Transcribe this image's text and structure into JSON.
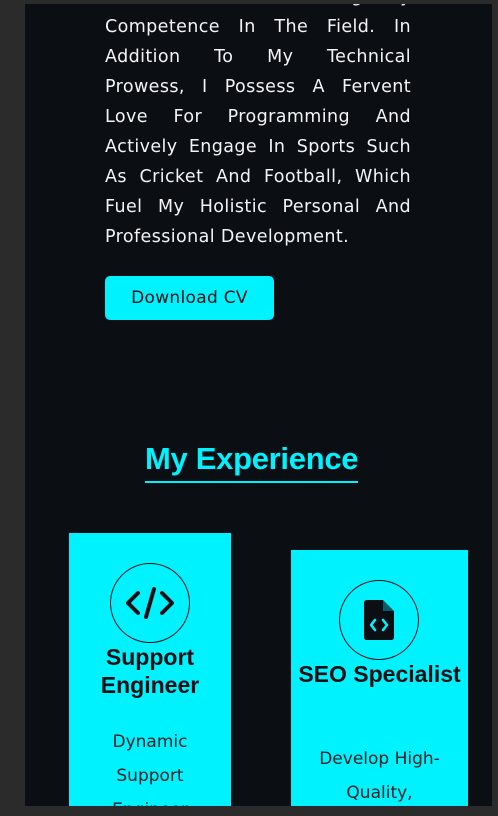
{
  "about": {
    "paragraph": "Innovation, Substantiating My Competence In The Field. In Addition To My Technical Prowess, I Possess A Fervent Love For Programming And Actively Engage In Sports Such As Cricket And Football, Which Fuel My Holistic Personal And Professional Development.",
    "download_label": "Download CV"
  },
  "experience": {
    "title": "My Experience",
    "cards": [
      {
        "icon": "code-icon",
        "title": "Support Engineer",
        "description": "Dynamic Support Engineer"
      },
      {
        "icon": "code-file-icon",
        "title": "SEO Specialist",
        "description": "Develop High-Quality,"
      }
    ]
  },
  "colors": {
    "background": "#0b0f13",
    "accent": "#00f2fe",
    "text": "#f2f4f6"
  }
}
